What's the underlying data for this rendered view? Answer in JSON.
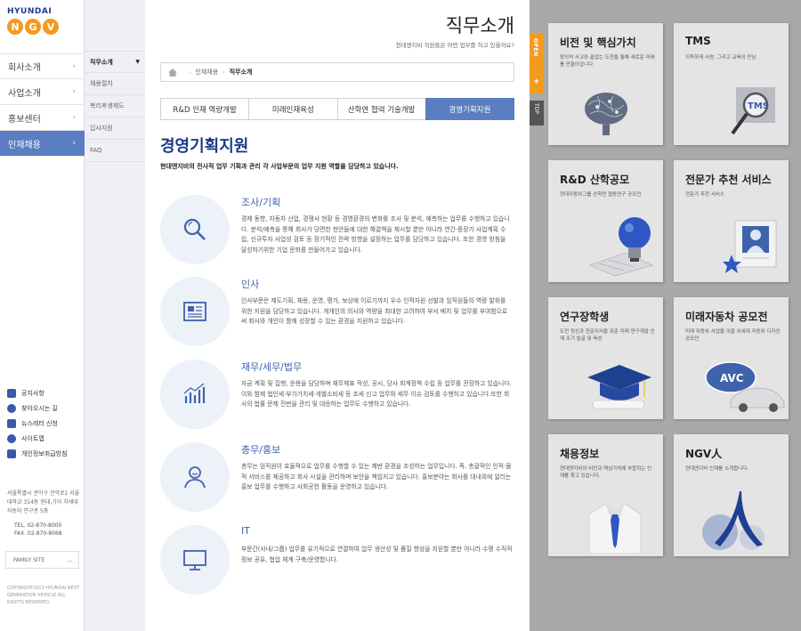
{
  "logo": {
    "brand": "HYUNDAI",
    "letters": [
      "N",
      "G",
      "V"
    ]
  },
  "main_nav": [
    {
      "label": "회사소개",
      "active": false
    },
    {
      "label": "사업소개",
      "active": false
    },
    {
      "label": "홍보센터",
      "active": false
    },
    {
      "label": "인재채용",
      "active": true
    }
  ],
  "sub_nav": [
    {
      "label": "직무소개",
      "active": true
    },
    {
      "label": "채용절차",
      "active": false
    },
    {
      "label": "복리후생제도",
      "active": false
    },
    {
      "label": "입사지원",
      "active": false
    },
    {
      "label": "FAQ",
      "active": false
    }
  ],
  "quick_links": [
    {
      "label": "공지사항",
      "icon": "calendar-icon"
    },
    {
      "label": "찾아오시는 길",
      "icon": "location-icon"
    },
    {
      "label": "뉴스레터 신청",
      "icon": "mail-icon"
    },
    {
      "label": "사이트맵",
      "icon": "sitemap-icon"
    },
    {
      "label": "개인정보취급방침",
      "icon": "document-icon"
    }
  ],
  "address": "서울특별시 관악구 관악로1 서울대학교 314동 현대,기아 차세대자동차 연구관 5층",
  "tel": "TEL. 02-870-8000",
  "fax": "FAX. 02-870-8068",
  "family_site": "FAMILY SITE",
  "copyright": "COPYRIGHT2013 HYUNDAI NEXT GENERATION VEHICLE.ALL RIGHTS RESERVED.",
  "page": {
    "title": "직무소개",
    "subtitle": "현대엔지비 직원들은 어떤 업무를 하고 있을까요?"
  },
  "breadcrumb": {
    "items": [
      "인재채용",
      "직무소개"
    ]
  },
  "tabs": [
    {
      "label": "R&D 인재 역량개발",
      "active": false
    },
    {
      "label": "미래인재육성",
      "active": false
    },
    {
      "label": "산학연 협력 기술개발",
      "active": false
    },
    {
      "label": "경영기획지원",
      "active": true
    }
  ],
  "section": {
    "title": "경영기획지원",
    "desc": "현대엔지비의 전사적 업무 기획과 관리 각 사업부문의 업무 지원 역할을 담당하고 있습니다."
  },
  "duties": [
    {
      "title": "조사/기획",
      "icon": "magnifier-icon",
      "desc": "경제 동향, 자동차 산업, 경쟁사 현황 등 경영환경의 변화를 조사 및 분석, 예측하는 업무를 수행하고 있습니다. 분석/예측을 통해 회사가 당면한 현안들에 대한 해결책을 제시할 뿐만 아니라 연간·중장기 사업계획 수립, 신규투자 사업성 검토 등 장기적인 전략 방향을 설정하는 업무를 담당하고 있습니다. 또한 경영 방침을 달성하기위한 기업 문화를 만들어가고 있습니다."
    },
    {
      "title": "인사",
      "icon": "newspaper-icon",
      "desc": "인사부문은 제도기획, 채용, 운영, 평가, 보상에 이르기까지 우수 인적자원 선발과 임직원들의 역량 발휘를 위한 지원을 담당하고 있습니다. 개개인의 의사와 역량을 최대한 고려하여 부서 배치 및 업무를 부여함으로써 회사와 개인이 함께 성장할 수 있는 환경을 지원하고 있습니다."
    },
    {
      "title": "재무/세무/법무",
      "icon": "chart-icon",
      "desc": "자금 계획 및 집행, 운용을 담당하며 재무제표 작성, 공시, 당사 회계정책 수립 등 업무를 관장하고 있습니다. 이와 함께 법인세·부가가치세·개별소비세 등 조세 신고 업무와 세무 이슈 검토를 수행하고 있습니다.또한 회사의 법률 문제 전반을 관리 및 대응하는 업무도 수행하고 있습니다."
    },
    {
      "title": "총무/홍보",
      "icon": "person-icon",
      "desc": "총무는 임직원이 효율적으로 업무를 수행할 수 있는 제반 환경을 조성하는 업무입니다. 즉, 총괄적인 인적·물적 서비스를 제공하고 회사 시설을 관리하며 보안을 책임지고 있습니다. 홍보분야는 회사를 대내외에 알리는 홍보 업무를 수행하고 사회공헌 활동을 운영하고 있습니다."
    },
    {
      "title": "IT",
      "icon": "monitor-icon",
      "desc": "부문간(사내/그룹) 업무를 유기적으로 연결하여 업무 생산성 및 품질 향상을 지원할 뿐만 아니라 수평 수직적 정보 공유, 협업 체계 구축/운영합니다."
    }
  ],
  "side_toggle": {
    "open": "OPEN",
    "plus": "+",
    "top": "TOP"
  },
  "cards": [
    {
      "title": "비전 및 핵심가치",
      "desc": "창의적 사고와 끝없는 도전을 통해 새로운 미래를 만들어갑니다",
      "icon": "brain-icon"
    },
    {
      "title": "TMS",
      "desc": "지독하게 사랑, 그리고 교육의 만남",
      "icon": "tms-magnifier-icon"
    },
    {
      "title": "R&D 산학공모",
      "desc": "현대자동차그룹 산학연 협동연구 공모전",
      "icon": "lightbulb-icon"
    },
    {
      "title": "전문가 추천 서비스",
      "desc": "전문가 추천 서비스",
      "icon": "profile-card-icon"
    },
    {
      "title": "연구장학생",
      "desc": "도전 정신과 전문지식을 갖춘 미래 연구개발 인재 조기 발굴 및 육성",
      "icon": "graduation-cap-icon"
    },
    {
      "title": "미래자동차 공모전",
      "desc": "미래 자동차 사업을 이끌 차세대 자동차 디자인 공모전",
      "icon": "car-icon",
      "badge": "AVC"
    },
    {
      "title": "채용정보",
      "desc": "현대엔지비의 비전과 핵심가치에 부합하는 인재를 찾고 있습니다.",
      "icon": "shirt-tie-icon"
    },
    {
      "title": "NGV人",
      "desc": "현대엔지비 인재를 소개합니다.",
      "icon": "person-figure-icon"
    }
  ],
  "colors": {
    "accent": "#5b7ec2",
    "title_blue": "#1b3d86",
    "orange": "#f39a1f",
    "panel_gray": "#a9a9a9"
  }
}
